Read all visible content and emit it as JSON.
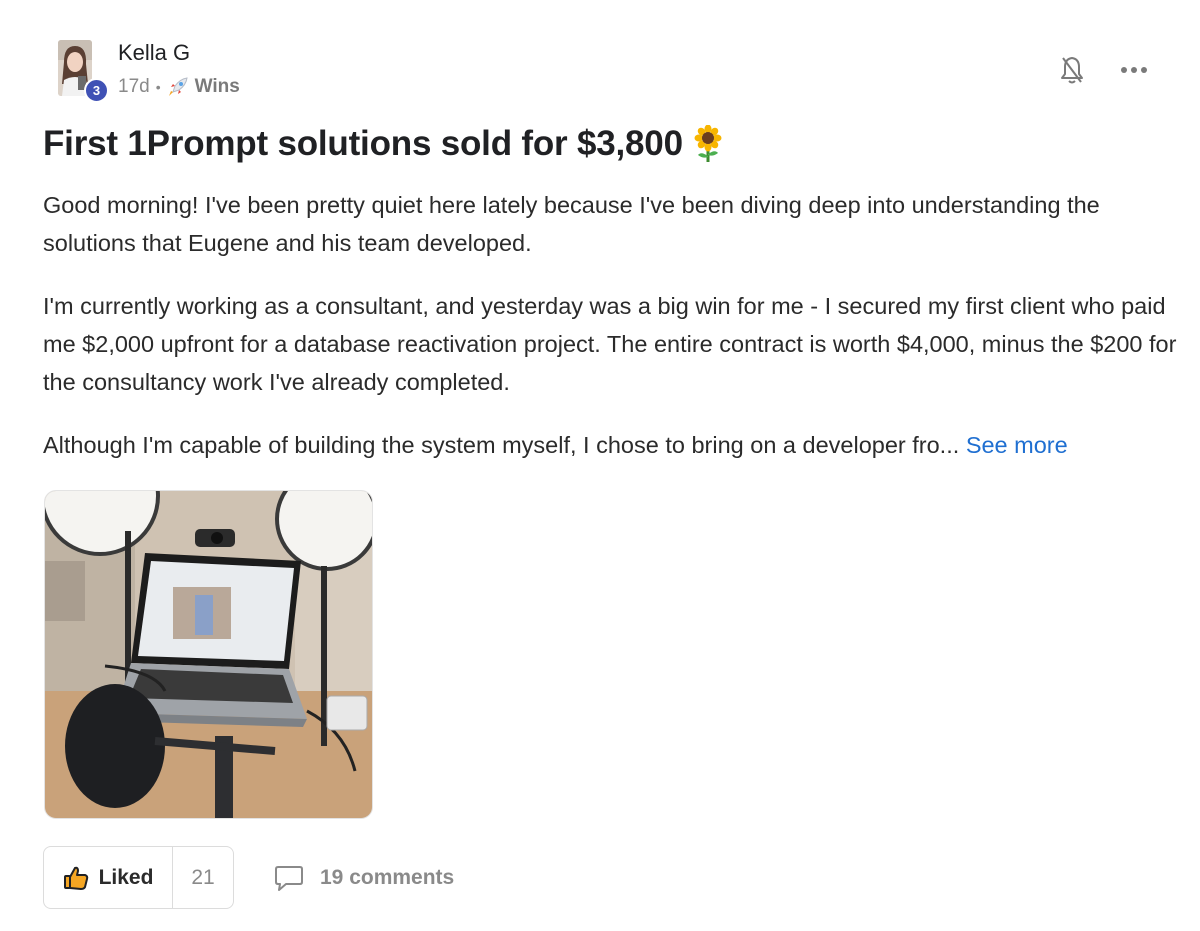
{
  "author": {
    "name": "Kella G",
    "level": "3",
    "avatar_icon": "avatar-photo"
  },
  "meta": {
    "age": "17d",
    "separator": "•",
    "category_icon": "rocket-icon",
    "category": "Wins"
  },
  "actions_top": {
    "bell_icon": "bell-off-icon",
    "more_icon": "more-icon"
  },
  "post": {
    "title": "First 1Prompt solutions sold for $3,800",
    "title_emoji": "sunflower-icon",
    "paragraph_1": "Good morning! I've been pretty quiet here lately because I've been diving deep into understanding the solutions that Eugene and his team developed.",
    "paragraph_2": "I'm currently working as a consultant, and yesterday was a big win for me - I secured my first client who paid me $2,000 upfront for a database reactivation project. The entire contract is worth $4,000, minus the $200 for the consultancy work I've already completed.",
    "paragraph_3": "Although I'm capable of building the system myself, I chose to bring on a developer fro...",
    "see_more": "See more",
    "image_icon": "photo-laptop-desk"
  },
  "footer": {
    "like_label": "Liked",
    "like_count": "21",
    "comments_label": "19 comments"
  },
  "colors": {
    "accent_link": "#1f6fd1",
    "badge": "#3f51b5",
    "text": "#202124",
    "muted": "#8a8a8a"
  }
}
